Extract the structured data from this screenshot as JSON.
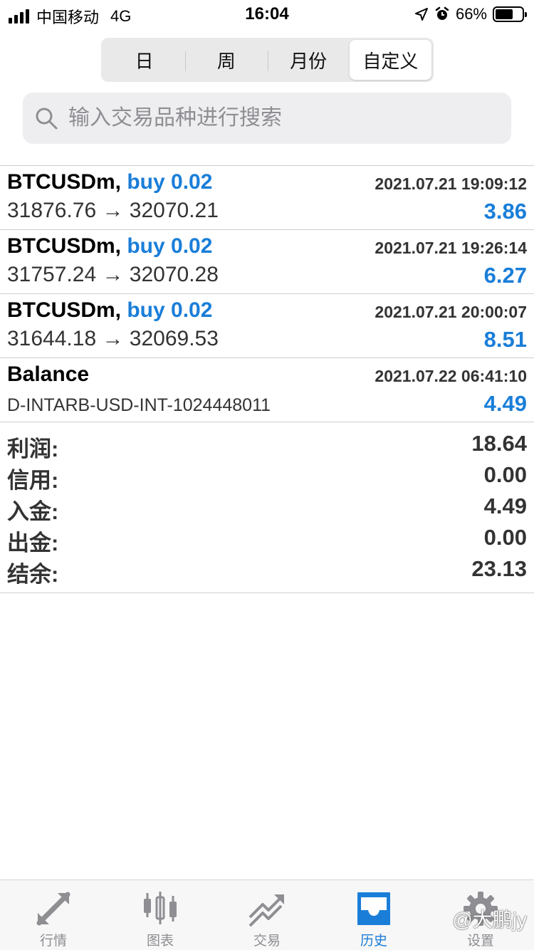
{
  "status_bar": {
    "carrier": "中国移动",
    "network": "4G",
    "time": "16:04",
    "battery": "66%",
    "battery_level": 0.66
  },
  "period_tabs": [
    {
      "label": "日",
      "active": false
    },
    {
      "label": "周",
      "active": false
    },
    {
      "label": "月份",
      "active": false
    },
    {
      "label": "自定义",
      "active": true
    }
  ],
  "search": {
    "placeholder": "输入交易品种进行搜索"
  },
  "deals": [
    {
      "symbol": "BTCUSDm,",
      "type": "buy 0.02",
      "time": "2021.07.21 19:09:12",
      "prices": "31876.76 → 32070.21",
      "profit": "3.86"
    },
    {
      "symbol": "BTCUSDm,",
      "type": "buy 0.02",
      "time": "2021.07.21 19:26:14",
      "prices": "31757.24 → 32070.28",
      "profit": "6.27"
    },
    {
      "symbol": "BTCUSDm,",
      "type": "buy 0.02",
      "time": "2021.07.21 20:00:07",
      "prices": "31644.18 → 32069.53",
      "profit": "8.51"
    }
  ],
  "balance_entry": {
    "title": "Balance",
    "time": "2021.07.22 06:41:10",
    "comment": "D-INTARB-USD-INT-1024448011",
    "amount": "4.49"
  },
  "summary": [
    {
      "label": "利润:",
      "value": "18.64"
    },
    {
      "label": "信用:",
      "value": "0.00"
    },
    {
      "label": "入金:",
      "value": "4.49"
    },
    {
      "label": "出金:",
      "value": "0.00"
    },
    {
      "label": "结余:",
      "value": "23.13"
    }
  ],
  "tabbar": [
    {
      "label": "行情",
      "icon": "quotes-arrows-icon",
      "active": false
    },
    {
      "label": "图表",
      "icon": "candlestick-chart-icon",
      "active": false
    },
    {
      "label": "交易",
      "icon": "trade-trend-icon",
      "active": false
    },
    {
      "label": "历史",
      "icon": "history-inbox-icon",
      "active": true
    },
    {
      "label": "设置",
      "icon": "gear-icon",
      "active": false
    }
  ],
  "watermark": "@大鹏jy",
  "colors": {
    "accent": "#1a7ed8",
    "inactive_icon": "#8e8e93"
  }
}
